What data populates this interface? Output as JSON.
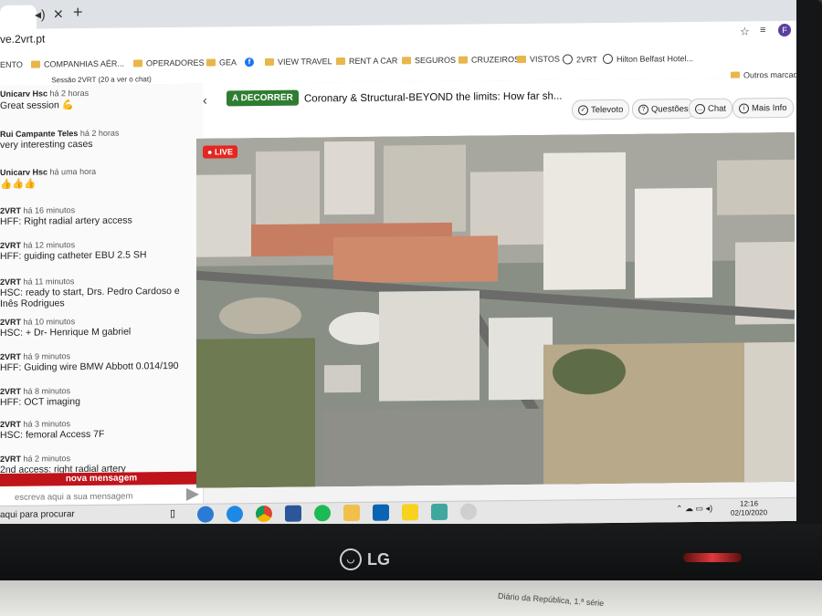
{
  "browser": {
    "url": "ve.2vrt.pt",
    "bookmarks": [
      {
        "label": "ENTO",
        "icon": "folder-icon"
      },
      {
        "label": "COMPANHIAS AÉR...",
        "icon": "folder-icon"
      },
      {
        "label": "OPERADORES",
        "icon": "folder-icon"
      },
      {
        "label": "GEA",
        "icon": "folder-icon"
      },
      {
        "label": "f",
        "icon": "facebook-icon"
      },
      {
        "label": "VIEW TRAVEL",
        "icon": "folder-icon"
      },
      {
        "label": "RENT A CAR",
        "icon": "folder-icon"
      },
      {
        "label": "SEGUROS",
        "icon": "folder-icon"
      },
      {
        "label": "CRUZEIROS",
        "icon": "folder-icon"
      },
      {
        "label": "VISTOS",
        "icon": "folder-icon"
      },
      {
        "label": "2VRT",
        "icon": "globe-icon"
      },
      {
        "label": "Hilton Belfast Hotel...",
        "icon": "hilton-icon"
      }
    ],
    "other_bookmarks": "Outros marcadores",
    "profile_initial": "F"
  },
  "chat": {
    "header": "Sessão 2VRT (20 a ver o chat)",
    "messages": [
      {
        "author": "Unicarv Hsc",
        "time": "há 2 horas",
        "text": "Great session 💪"
      },
      {
        "author": "Rui Campante Teles",
        "time": "há 2 horas",
        "text": "very interesting cases"
      },
      {
        "author": "Unicarv Hsc",
        "time": "há uma hora",
        "text": "👍👍👍"
      },
      {
        "author": "2VRT",
        "time": "há 16 minutos",
        "text": "HFF: Right radial artery access"
      },
      {
        "author": "2VRT",
        "time": "há 12 minutos",
        "text": "HFF: guiding catheter EBU 2.5 SH"
      },
      {
        "author": "2VRT",
        "time": "há 11 minutos",
        "text": "HSC: ready to start, Drs. Pedro Cardoso e Inês Rodrigues"
      },
      {
        "author": "2VRT",
        "time": "há 10 minutos",
        "text": "HSC: + Dr- Henrique M gabriel"
      },
      {
        "author": "2VRT",
        "time": "há 9 minutos",
        "text": "HFF: Guiding wire BMW Abbott 0.014/190"
      },
      {
        "author": "2VRT",
        "time": "há 8 minutos",
        "text": "HFF: OCT imaging"
      },
      {
        "author": "2VRT",
        "time": "há 3 minutos",
        "text": "HSC: femoral Access 7F"
      },
      {
        "author": "2VRT",
        "time": "há 2 minutos",
        "text": "2nd access: right radial artery"
      }
    ],
    "new_message_banner": "nova mensagem",
    "input_placeholder": "escreva aqui a sua mensagem"
  },
  "session": {
    "status": "A DECORRER",
    "title": "Coronary & Structural-BEYOND the limits: How far sh...",
    "buttons": [
      {
        "label": "Televoto",
        "icon": "check-icon"
      },
      {
        "label": "Questões",
        "icon": "question-icon"
      },
      {
        "label": "Chat",
        "icon": "chat-icon"
      },
      {
        "label": "Mais Info",
        "icon": "info-icon"
      }
    ],
    "live_tag": "LIVE"
  },
  "taskbar": {
    "search": "aqui para procurar",
    "time": "12:16",
    "date": "02/10/2020"
  },
  "monitor": {
    "brand": "LG"
  },
  "desk": {
    "paper_text": "Diário da República, 1.ª série"
  }
}
